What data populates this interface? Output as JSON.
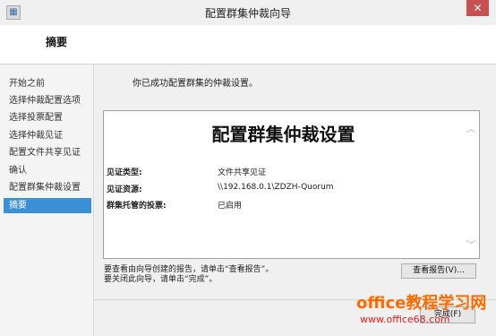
{
  "window": {
    "title": "配置群集仲裁向导",
    "close_label": "✕"
  },
  "header": {
    "title": "摘要"
  },
  "sidebar": {
    "items": [
      {
        "label": "开始之前",
        "active": false
      },
      {
        "label": "选择仲裁配置选项",
        "active": false
      },
      {
        "label": "选择投票配置",
        "active": false
      },
      {
        "label": "选择仲裁见证",
        "active": false
      },
      {
        "label": "配置文件共享见证",
        "active": false
      },
      {
        "label": "确认",
        "active": false
      },
      {
        "label": "配置群集仲裁设置",
        "active": false
      },
      {
        "label": "摘要",
        "active": true
      }
    ]
  },
  "main": {
    "intro": "你已成功配置群集的仲裁设置。",
    "report": {
      "title": "配置群集仲裁设置",
      "rows": [
        {
          "label": "见证类型:",
          "value": "文件共享见证"
        },
        {
          "label": "见证资源:",
          "value": "\\\\192.168.0.1\\ZDZH-Quorum"
        },
        {
          "label": "群集托管的投票:",
          "value": "已启用"
        }
      ]
    },
    "notes": [
      "要查看由向导创建的报告，请单击“查看报告”。",
      "要关闭此向导，请单击“完成”。"
    ],
    "view_report_label": "查看报告(V)...",
    "finish_label": "完成(F)"
  },
  "watermark": {
    "main": "office教程学习网",
    "sub": "www.office68.com"
  },
  "colors": {
    "accent": "#3b8fd6",
    "close": "#c75050",
    "watermark_main": "#ff6a00",
    "watermark_sub": "#e02020"
  }
}
